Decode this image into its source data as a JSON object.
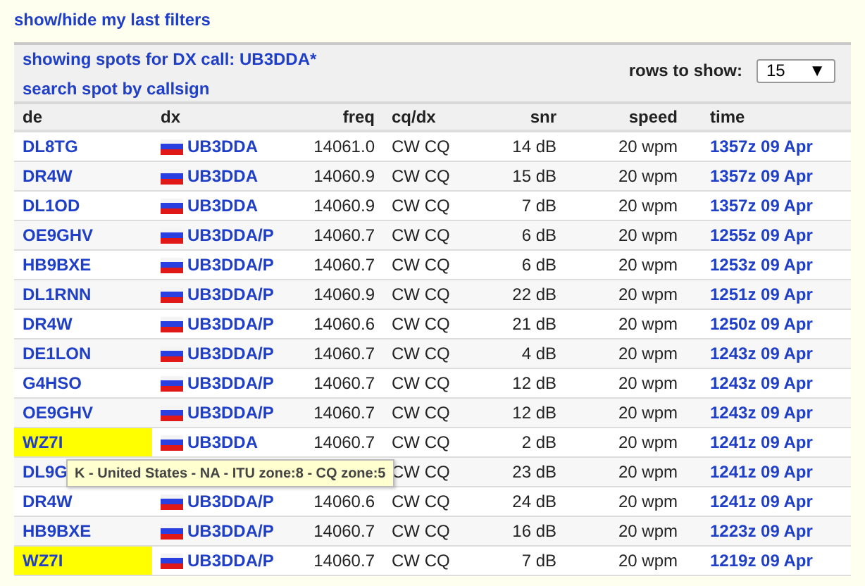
{
  "filters_link": "show/hide my last filters",
  "header": {
    "title": "showing spots for DX call: UB3DDA*",
    "search_link": "search spot by callsign",
    "rows_label": "rows to show:",
    "rows_value": "15",
    "rows_arrow": "▼"
  },
  "columns": [
    "de",
    "dx",
    "freq",
    "cq/dx",
    "snr",
    "speed",
    "time"
  ],
  "rows": [
    {
      "de": "DL8TG",
      "highlight": false,
      "dx": "UB3DDA",
      "freq": "14061.0",
      "mode": "CW CQ",
      "snr": "14 dB",
      "speed": "20 wpm",
      "time": "1357z 09 Apr"
    },
    {
      "de": "DR4W",
      "highlight": false,
      "dx": "UB3DDA",
      "freq": "14060.9",
      "mode": "CW CQ",
      "snr": "15 dB",
      "speed": "20 wpm",
      "time": "1357z 09 Apr"
    },
    {
      "de": "DL1OD",
      "highlight": false,
      "dx": "UB3DDA",
      "freq": "14060.9",
      "mode": "CW CQ",
      "snr": "7 dB",
      "speed": "20 wpm",
      "time": "1357z 09 Apr"
    },
    {
      "de": "OE9GHV",
      "highlight": false,
      "dx": "UB3DDA/P",
      "freq": "14060.7",
      "mode": "CW CQ",
      "snr": "6 dB",
      "speed": "20 wpm",
      "time": "1255z 09 Apr"
    },
    {
      "de": "HB9BXE",
      "highlight": false,
      "dx": "UB3DDA/P",
      "freq": "14060.7",
      "mode": "CW CQ",
      "snr": "6 dB",
      "speed": "20 wpm",
      "time": "1253z 09 Apr"
    },
    {
      "de": "DL1RNN",
      "highlight": false,
      "dx": "UB3DDA/P",
      "freq": "14060.9",
      "mode": "CW CQ",
      "snr": "22 dB",
      "speed": "20 wpm",
      "time": "1251z 09 Apr"
    },
    {
      "de": "DR4W",
      "highlight": false,
      "dx": "UB3DDA/P",
      "freq": "14060.6",
      "mode": "CW CQ",
      "snr": "21 dB",
      "speed": "20 wpm",
      "time": "1250z 09 Apr"
    },
    {
      "de": "DE1LON",
      "highlight": false,
      "dx": "UB3DDA/P",
      "freq": "14060.7",
      "mode": "CW CQ",
      "snr": "4 dB",
      "speed": "20 wpm",
      "time": "1243z 09 Apr"
    },
    {
      "de": "G4HSO",
      "highlight": false,
      "dx": "UB3DDA/P",
      "freq": "14060.7",
      "mode": "CW CQ",
      "snr": "12 dB",
      "speed": "20 wpm",
      "time": "1243z 09 Apr"
    },
    {
      "de": "OE9GHV",
      "highlight": false,
      "dx": "UB3DDA/P",
      "freq": "14060.7",
      "mode": "CW CQ",
      "snr": "12 dB",
      "speed": "20 wpm",
      "time": "1243z 09 Apr"
    },
    {
      "de": "WZ7I",
      "highlight": true,
      "dx": "UB3DDA",
      "freq": "14060.7",
      "mode": "CW CQ",
      "snr": "2 dB",
      "speed": "20 wpm",
      "time": "1241z 09 Apr"
    },
    {
      "de": "DL9G",
      "highlight": false,
      "mode": "CW CQ",
      "snr": "23 dB",
      "speed": "20 wpm",
      "time": "1241z 09 Apr"
    },
    {
      "de": "DR4W",
      "highlight": false,
      "dx": "UB3DDA/P",
      "freq": "14060.6",
      "mode": "CW CQ",
      "snr": "24 dB",
      "speed": "20 wpm",
      "time": "1241z 09 Apr"
    },
    {
      "de": "HB9BXE",
      "highlight": false,
      "dx": "UB3DDA/P",
      "freq": "14060.7",
      "mode": "CW CQ",
      "snr": "16 dB",
      "speed": "20 wpm",
      "time": "1223z 09 Apr"
    },
    {
      "de": "WZ7I",
      "highlight": true,
      "dx": "UB3DDA/P",
      "freq": "14060.7",
      "mode": "CW CQ",
      "snr": "7 dB",
      "speed": "20 wpm",
      "time": "1219z 09 Apr"
    }
  ],
  "tooltip": "K - United States - NA - ITU zone:8 - CQ zone:5"
}
